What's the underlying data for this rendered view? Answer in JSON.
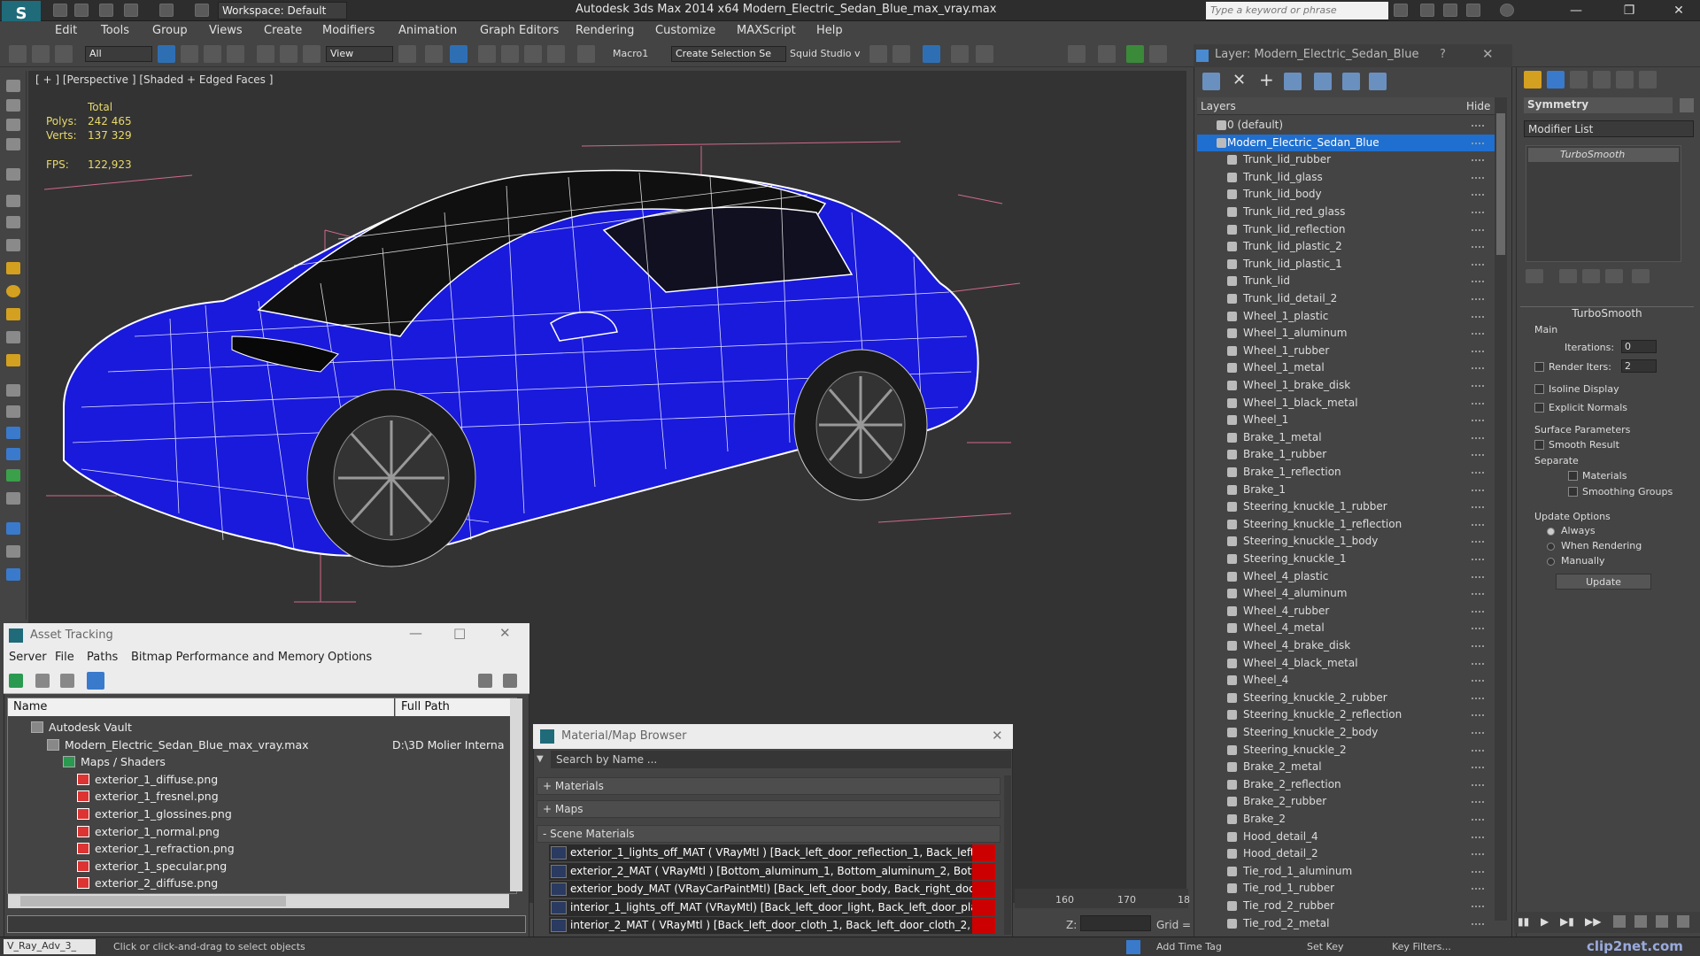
{
  "app": {
    "title": "Autodesk 3ds Max  2014 x64      Modern_Electric_Sedan_Blue_max_vray.max",
    "workspace": "Workspace: Default",
    "search_placeholder": "Type a keyword or phrase"
  },
  "menu": [
    "Edit",
    "Tools",
    "Group",
    "Views",
    "Create",
    "Modifiers",
    "Animation",
    "Graph Editors",
    "Rendering",
    "Customize",
    "MAXScript",
    "Help"
  ],
  "toolbar": {
    "selection_filter": "All",
    "ref_coord": "View",
    "macro": "Macro1",
    "selection_set": "Create Selection Se",
    "squid": "Squid Studio v"
  },
  "viewport": {
    "label": "[ + ] [Perspective ] [Shaded + Edged Faces ]",
    "stats_total": "Total",
    "polys_label": "Polys:",
    "polys_value": "242 465",
    "verts_label": "Verts:",
    "verts_value": "137 329",
    "fps_label": "FPS:",
    "fps_value": "122,923",
    "car_color": "#1a1adc"
  },
  "layers": {
    "title": "Layer: Modern_Electric_Sedan_Blue",
    "help": "?",
    "col_layers": "Layers",
    "col_hide": "Hide",
    "items": [
      "0 (default)",
      "Modern_Electric_Sedan_Blue",
      "Trunk_lid_rubber",
      "Trunk_lid_glass",
      "Trunk_lid_body",
      "Trunk_lid_red_glass",
      "Trunk_lid_reflection",
      "Trunk_lid_plastic_2",
      "Trunk_lid_plastic_1",
      "Trunk_lid",
      "Trunk_lid_detail_2",
      "Wheel_1_plastic",
      "Wheel_1_aluminum",
      "Wheel_1_rubber",
      "Wheel_1_metal",
      "Wheel_1_brake_disk",
      "Wheel_1_black_metal",
      "Wheel_1",
      "Brake_1_metal",
      "Brake_1_rubber",
      "Brake_1_reflection",
      "Brake_1",
      "Steering_knuckle_1_rubber",
      "Steering_knuckle_1_reflection",
      "Steering_knuckle_1_body",
      "Steering_knuckle_1",
      "Wheel_4_plastic",
      "Wheel_4_aluminum",
      "Wheel_4_rubber",
      "Wheel_4_metal",
      "Wheel_4_brake_disk",
      "Wheel_4_black_metal",
      "Wheel_4",
      "Steering_knuckle_2_rubber",
      "Steering_knuckle_2_reflection",
      "Steering_knuckle_2_body",
      "Steering_knuckle_2",
      "Brake_2_metal",
      "Brake_2_reflection",
      "Brake_2_rubber",
      "Brake_2",
      "Hood_detail_4",
      "Hood_detail_2",
      "Tie_rod_1_aluminum",
      "Tie_rod_1_rubber",
      "Tie_rod_2_rubber",
      "Tie_rod_2_metal"
    ]
  },
  "cmdpanel": {
    "modifier_name": "Symmetry",
    "modifier_list": "Modifier List",
    "stack_item": "TurboSmooth",
    "rollout": "TurboSmooth",
    "main": "Main",
    "iterations_label": "Iterations:",
    "iterations_value": "0",
    "render_iters_label": "Render Iters:",
    "render_iters_value": "2",
    "isoline": "Isoline Display",
    "explicit": "Explicit Normals",
    "surface_params": "Surface Parameters",
    "smooth_result": "Smooth Result",
    "separate": "Separate",
    "materials": "Materials",
    "smoothing_groups": "Smoothing Groups",
    "update_options": "Update Options",
    "always": "Always",
    "when_rendering": "When Rendering",
    "manually": "Manually",
    "update_btn": "Update"
  },
  "asset": {
    "title": "Asset Tracking",
    "menu": [
      "Server",
      "File",
      "Paths",
      "Bitmap Performance and Memory",
      "Options"
    ],
    "col_name": "Name",
    "col_path": "Full Path",
    "rows": [
      {
        "name": "Autodesk Vault",
        "path": ""
      },
      {
        "name": "Modern_Electric_Sedan_Blue_max_vray.max",
        "path": "D:\\3D Molier Interna"
      },
      {
        "name": "Maps / Shaders",
        "path": ""
      },
      {
        "name": "exterior_1_diffuse.png",
        "path": ""
      },
      {
        "name": "exterior_1_fresnel.png",
        "path": ""
      },
      {
        "name": "exterior_1_glossines.png",
        "path": ""
      },
      {
        "name": "exterior_1_normal.png",
        "path": ""
      },
      {
        "name": "exterior_1_refraction.png",
        "path": ""
      },
      {
        "name": "exterior_1_specular.png",
        "path": ""
      },
      {
        "name": "exterior_2_diffuse.png",
        "path": ""
      }
    ]
  },
  "matbrowser": {
    "title": "Material/Map Browser",
    "search": "Search by Name ...",
    "sections": [
      "+ Materials",
      "+ Maps",
      "- Scene Materials"
    ],
    "rows": [
      "exterior_1_lights_off_MAT ( VRayMtl ) [Back_left_door_reflection_1, Back_left_...",
      "exterior_2_MAT  ( VRayMtl ) [Bottom_aluminum_1, Bottom_aluminum_2, Botto...",
      "exterior_body_MAT (VRayCarPaintMtl) [Back_left_door_body, Back_right_door...",
      "interior_1_lights_off_MAT (VRayMtl) [Back_left_door_light, Back_left_door_pla...",
      "interior_2_MAT ( VRayMtl ) [Back_left_door_cloth_1, Back_left_door_cloth_2, B..."
    ]
  },
  "timeline": {
    "t160": "160",
    "t170": "170",
    "t180": "18"
  },
  "status": {
    "script": "V_Ray_Adv_3_",
    "prompt": "Click or click-and-drag to select objects",
    "add_time_tag": "Add Time Tag",
    "set_key": "Set Key",
    "key_filters": "Key Filters...",
    "z_label": "Z:",
    "grid_label": "Grid =",
    "watermark": "clip2net.com"
  }
}
